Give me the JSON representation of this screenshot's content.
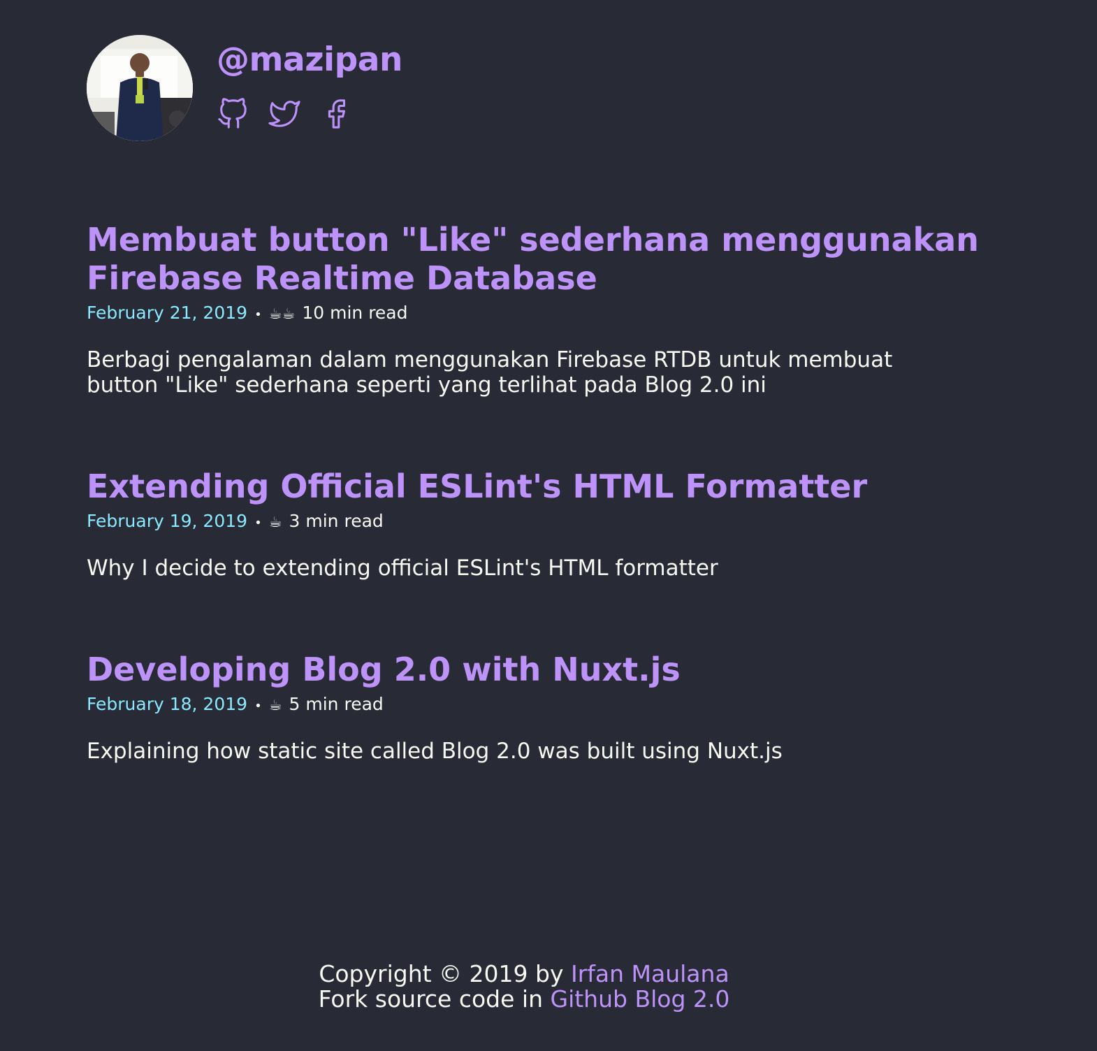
{
  "header": {
    "avatar_alt": "@mazipan",
    "username": "@mazipan",
    "socials": [
      {
        "icon": "github-icon",
        "label": "GitHub"
      },
      {
        "icon": "twitter-icon",
        "label": "Twitter"
      },
      {
        "icon": "facebook-icon",
        "label": "Facebook"
      }
    ]
  },
  "posts": [
    {
      "title": "Membuat button \"Like\" sederhana menggunakan Firebase Realtime Database",
      "date": "February 21, 2019",
      "separator": "•",
      "cups": "☕☕",
      "read_time": "10 min read",
      "description": "Berbagi pengalaman dalam menggunakan Firebase RTDB untuk membuat button \"Like\" sederhana seperti yang terlihat pada Blog 2.0 ini"
    },
    {
      "title": "Extending Official ESLint's HTML Formatter",
      "date": "February 19, 2019",
      "separator": "•",
      "cups": "☕",
      "read_time": "3 min read",
      "description": "Why I decide to extending official ESLint's HTML formatter"
    },
    {
      "title": "Developing Blog 2.0 with Nuxt.js",
      "date": "February 18, 2019",
      "separator": "•",
      "cups": "☕",
      "read_time": "5 min read",
      "description": "Explaining how static site called Blog 2.0 was built using Nuxt.js"
    }
  ],
  "footer": {
    "copyright_prefix": "Copyright © 2019 by ",
    "author_link": "Irfan Maulana",
    "fork_prefix": "Fork source code in ",
    "repo_link": "Github Blog 2.0"
  },
  "colors": {
    "background": "#282a36",
    "accent": "#bd93f9",
    "date": "#8be9fd",
    "text": "#f8f8f2"
  }
}
